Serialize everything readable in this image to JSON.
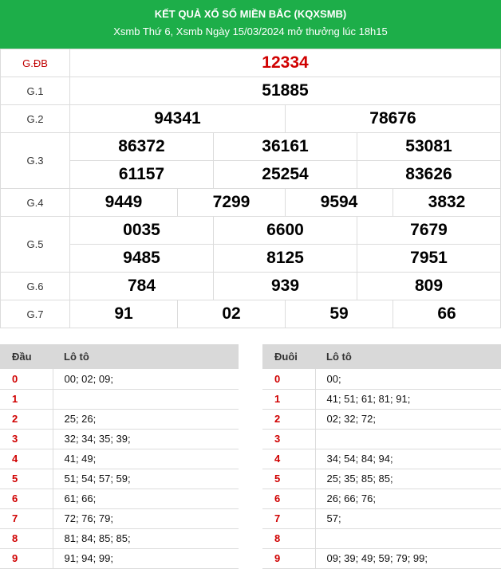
{
  "header": {
    "title": "KẾT QUẢ XỔ SỐ MIỀN BẮC (KQXSMB)",
    "subtitle": "Xsmb Thứ 6, Xsmb Ngày 15/03/2024 mở thưởng lúc 18h15"
  },
  "prizes": {
    "db": {
      "label": "G.ĐB",
      "nums": [
        "12334"
      ]
    },
    "g1": {
      "label": "G.1",
      "nums": [
        "51885"
      ]
    },
    "g2": {
      "label": "G.2",
      "nums": [
        "94341",
        "78676"
      ]
    },
    "g3": {
      "label": "G.3",
      "nums": [
        "86372",
        "36161",
        "53081",
        "61157",
        "25254",
        "83626"
      ]
    },
    "g4": {
      "label": "G.4",
      "nums": [
        "9449",
        "7299",
        "9594",
        "3832"
      ]
    },
    "g5": {
      "label": "G.5",
      "nums": [
        "0035",
        "6600",
        "7679",
        "9485",
        "8125",
        "7951"
      ]
    },
    "g6": {
      "label": "G.6",
      "nums": [
        "784",
        "939",
        "809"
      ]
    },
    "g7": {
      "label": "G.7",
      "nums": [
        "91",
        "02",
        "59",
        "66"
      ]
    }
  },
  "loto_head": {
    "col1": "Đầu",
    "col2": "Lô tô",
    "rows": [
      {
        "k": "0",
        "v": "00; 02; 09;"
      },
      {
        "k": "1",
        "v": ""
      },
      {
        "k": "2",
        "v": "25; 26;"
      },
      {
        "k": "3",
        "v": "32; 34; 35; 39;"
      },
      {
        "k": "4",
        "v": "41; 49;"
      },
      {
        "k": "5",
        "v": "51; 54; 57; 59;"
      },
      {
        "k": "6",
        "v": "61; 66;"
      },
      {
        "k": "7",
        "v": "72; 76; 79;"
      },
      {
        "k": "8",
        "v": "81; 84; 85; 85;"
      },
      {
        "k": "9",
        "v": "91; 94; 99;"
      }
    ]
  },
  "loto_tail": {
    "col1": "Đuôi",
    "col2": "Lô tô",
    "rows": [
      {
        "k": "0",
        "v": "00;"
      },
      {
        "k": "1",
        "v": "41; 51; 61; 81; 91;"
      },
      {
        "k": "2",
        "v": "02; 32; 72;"
      },
      {
        "k": "3",
        "v": ""
      },
      {
        "k": "4",
        "v": "34; 54; 84; 94;"
      },
      {
        "k": "5",
        "v": "25; 35; 85; 85;"
      },
      {
        "k": "6",
        "v": "26; 66; 76;"
      },
      {
        "k": "7",
        "v": "57;"
      },
      {
        "k": "8",
        "v": ""
      },
      {
        "k": "9",
        "v": "09; 39; 49; 59; 79; 99;"
      }
    ]
  }
}
